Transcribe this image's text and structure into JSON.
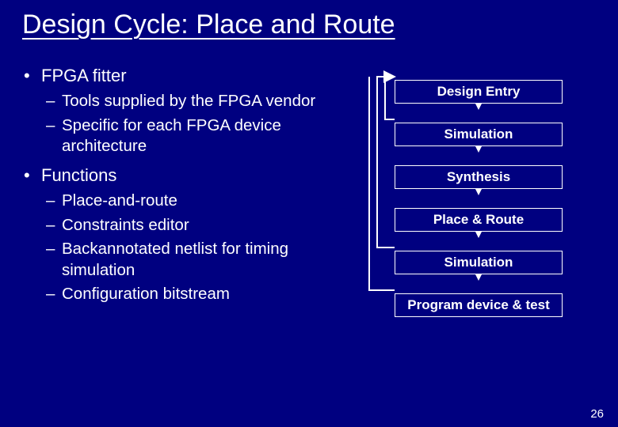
{
  "title": "Design Cycle: Place and Route",
  "left": {
    "b1": "FPGA fitter",
    "b1_subs": [
      "Tools supplied by the FPGA vendor",
      "Specific for each FPGA device architecture"
    ],
    "b2": "Functions",
    "b2_subs": [
      "Place-and-route",
      "Constraints editor",
      "Backannotated netlist for timing simulation",
      "Configuration bitstream"
    ]
  },
  "flow": {
    "stages": [
      "Design Entry",
      "Simulation",
      "Synthesis",
      "Place & Route",
      "Simulation",
      "Program device & test"
    ]
  },
  "page_number": "26"
}
